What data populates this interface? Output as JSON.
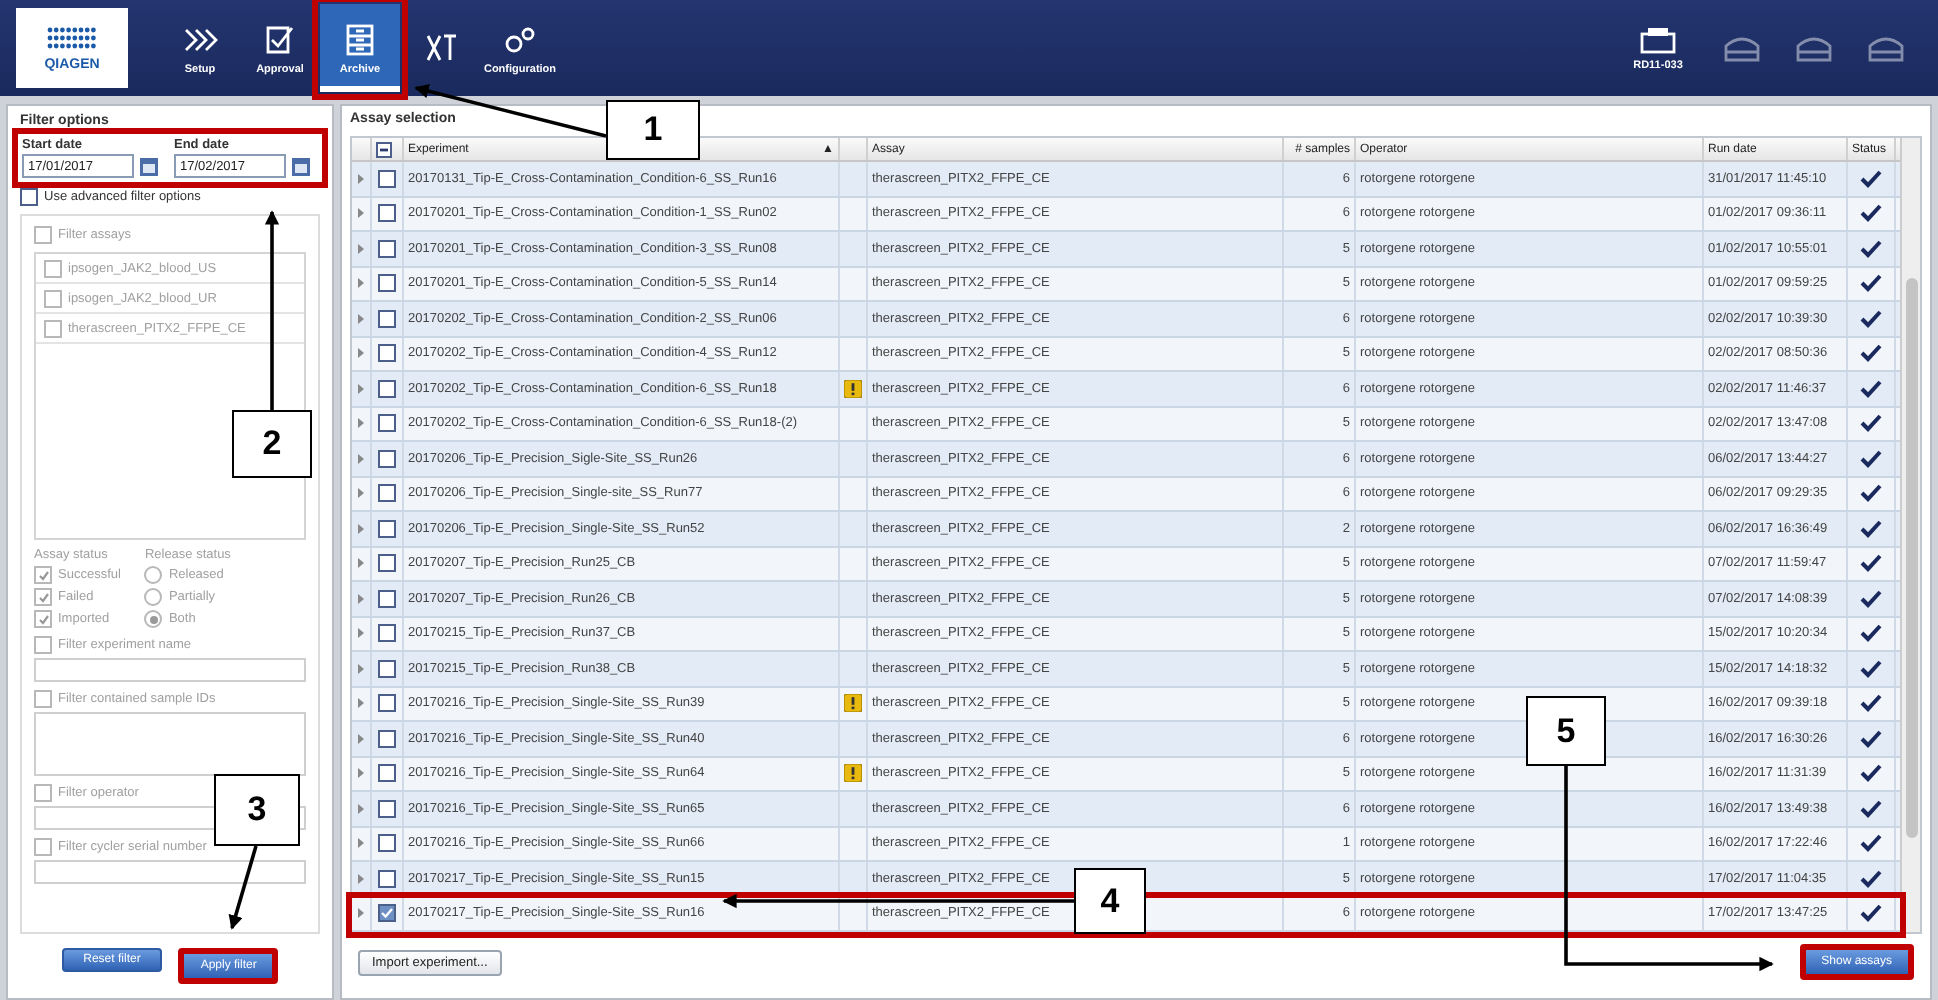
{
  "toolbar": {
    "logo": "QIAGEN",
    "nav": [
      {
        "label": "Setup",
        "selected": false,
        "highlighted": false
      },
      {
        "label": "Approval",
        "selected": false,
        "highlighted": false
      },
      {
        "label": "Archive",
        "selected": true,
        "highlighted": true
      },
      {
        "selected": false,
        "highlighted": false
      },
      {
        "label": "Configuration",
        "selected": false,
        "highlighted": false
      }
    ],
    "instrument": {
      "label": "RD11-033"
    },
    "slots": [
      {
        "disabled": true
      },
      {
        "disabled": true
      },
      {
        "disabled": true
      }
    ]
  },
  "filter": {
    "title": "Filter options",
    "dates_highlighted": true,
    "start_date": {
      "label": "Start date",
      "value": "17/01/2017"
    },
    "end_date": {
      "label": "End date",
      "value": "17/02/2017"
    },
    "advanced": {
      "label": "Use advanced filter options",
      "checked": false
    },
    "filter_assays": {
      "label": "Filter assays",
      "checked": false,
      "items": [
        {
          "label": "ipsogen_JAK2_blood_US",
          "checked": false
        },
        {
          "label": "ipsogen_JAK2_blood_UR",
          "checked": false
        },
        {
          "label": "therascreen_PITX2_FFPE_CE",
          "checked": false
        }
      ]
    },
    "assay_status": {
      "title": "Assay status",
      "items": [
        {
          "label": "Successful",
          "checked": true
        },
        {
          "label": "Failed",
          "checked": true
        },
        {
          "label": "Imported",
          "checked": true
        }
      ]
    },
    "release_status": {
      "title": "Release status",
      "items": [
        {
          "label": "Released",
          "selected": false
        },
        {
          "label": "Partially",
          "selected": false
        },
        {
          "label": "Both",
          "selected": true
        }
      ]
    },
    "text_filters": [
      {
        "label": "Filter experiment name",
        "checked": false,
        "kind": "text"
      },
      {
        "label": "Filter contained sample IDs",
        "checked": false,
        "kind": "area"
      },
      {
        "label": "Filter operator",
        "checked": false,
        "kind": "select"
      },
      {
        "label": "Filter cycler serial number",
        "checked": false,
        "kind": "text"
      }
    ],
    "buttons": [
      {
        "label": "Reset filter",
        "highlighted": false
      },
      {
        "label": "Apply filter",
        "highlighted": true
      }
    ]
  },
  "assay_selection": {
    "title": "Assay selection",
    "columns": [
      "Experiment",
      "Assay",
      "# samples",
      "Operator",
      "Run date",
      "Status"
    ],
    "sort_mark": "▲",
    "header_partial": true,
    "rows": [
      {
        "experiment": "20170131_Tip-E_Cross-Contamination_Condition-6_SS_Run16",
        "warning": false,
        "assay": "therascreen_PITX2_FFPE_CE",
        "samples": "6",
        "operator": "rotorgene rotorgene",
        "run_date": "31/01/2017 11:45:10",
        "passed": true,
        "checked": false,
        "highlighted": false
      },
      {
        "experiment": "20170201_Tip-E_Cross-Contamination_Condition-1_SS_Run02",
        "warning": false,
        "assay": "therascreen_PITX2_FFPE_CE",
        "samples": "6",
        "operator": "rotorgene rotorgene",
        "run_date": "01/02/2017 09:36:11",
        "passed": true,
        "checked": false,
        "highlighted": false
      },
      {
        "experiment": "20170201_Tip-E_Cross-Contamination_Condition-3_SS_Run08",
        "warning": false,
        "assay": "therascreen_PITX2_FFPE_CE",
        "samples": "5",
        "operator": "rotorgene rotorgene",
        "run_date": "01/02/2017 10:55:01",
        "passed": true,
        "checked": false,
        "highlighted": false
      },
      {
        "experiment": "20170201_Tip-E_Cross-Contamination_Condition-5_SS_Run14",
        "warning": false,
        "assay": "therascreen_PITX2_FFPE_CE",
        "samples": "5",
        "operator": "rotorgene rotorgene",
        "run_date": "01/02/2017 09:59:25",
        "passed": true,
        "checked": false,
        "highlighted": false
      },
      {
        "experiment": "20170202_Tip-E_Cross-Contamination_Condition-2_SS_Run06",
        "warning": false,
        "assay": "therascreen_PITX2_FFPE_CE",
        "samples": "6",
        "operator": "rotorgene rotorgene",
        "run_date": "02/02/2017 10:39:30",
        "passed": true,
        "checked": false,
        "highlighted": false
      },
      {
        "experiment": "20170202_Tip-E_Cross-Contamination_Condition-4_SS_Run12",
        "warning": false,
        "assay": "therascreen_PITX2_FFPE_CE",
        "samples": "5",
        "operator": "rotorgene rotorgene",
        "run_date": "02/02/2017 08:50:36",
        "passed": true,
        "checked": false,
        "highlighted": false
      },
      {
        "experiment": "20170202_Tip-E_Cross-Contamination_Condition-6_SS_Run18",
        "warning": true,
        "assay": "therascreen_PITX2_FFPE_CE",
        "samples": "6",
        "operator": "rotorgene rotorgene",
        "run_date": "02/02/2017 11:46:37",
        "passed": true,
        "checked": false,
        "highlighted": false
      },
      {
        "experiment": "20170202_Tip-E_Cross-Contamination_Condition-6_SS_Run18-(2)",
        "warning": false,
        "assay": "therascreen_PITX2_FFPE_CE",
        "samples": "5",
        "operator": "rotorgene rotorgene",
        "run_date": "02/02/2017 13:47:08",
        "passed": true,
        "checked": false,
        "highlighted": false
      },
      {
        "experiment": "20170206_Tip-E_Precision_Sigle-Site_SS_Run26",
        "warning": false,
        "assay": "therascreen_PITX2_FFPE_CE",
        "samples": "6",
        "operator": "rotorgene rotorgene",
        "run_date": "06/02/2017 13:44:27",
        "passed": true,
        "checked": false,
        "highlighted": false
      },
      {
        "experiment": "20170206_Tip-E_Precision_Single-site_SS_Run77",
        "warning": false,
        "assay": "therascreen_PITX2_FFPE_CE",
        "samples": "6",
        "operator": "rotorgene rotorgene",
        "run_date": "06/02/2017 09:29:35",
        "passed": true,
        "checked": false,
        "highlighted": false
      },
      {
        "experiment": "20170206_Tip-E_Precision_Single-Site_SS_Run52",
        "warning": false,
        "assay": "therascreen_PITX2_FFPE_CE",
        "samples": "2",
        "operator": "rotorgene rotorgene",
        "run_date": "06/02/2017 16:36:49",
        "passed": true,
        "checked": false,
        "highlighted": false
      },
      {
        "experiment": "20170207_Tip-E_Precision_Run25_CB",
        "warning": false,
        "assay": "therascreen_PITX2_FFPE_CE",
        "samples": "5",
        "operator": "rotorgene rotorgene",
        "run_date": "07/02/2017 11:59:47",
        "passed": true,
        "checked": false,
        "highlighted": false
      },
      {
        "experiment": "20170207_Tip-E_Precision_Run26_CB",
        "warning": false,
        "assay": "therascreen_PITX2_FFPE_CE",
        "samples": "5",
        "operator": "rotorgene rotorgene",
        "run_date": "07/02/2017 14:08:39",
        "passed": true,
        "checked": false,
        "highlighted": false
      },
      {
        "experiment": "20170215_Tip-E_Precision_Run37_CB",
        "warning": false,
        "assay": "therascreen_PITX2_FFPE_CE",
        "samples": "5",
        "operator": "rotorgene rotorgene",
        "run_date": "15/02/2017 10:20:34",
        "passed": true,
        "checked": false,
        "highlighted": false
      },
      {
        "experiment": "20170215_Tip-E_Precision_Run38_CB",
        "warning": false,
        "assay": "therascreen_PITX2_FFPE_CE",
        "samples": "5",
        "operator": "rotorgene rotorgene",
        "run_date": "15/02/2017 14:18:32",
        "passed": true,
        "checked": false,
        "highlighted": false
      },
      {
        "experiment": "20170216_Tip-E_Precision_Single-Site_SS_Run39",
        "warning": true,
        "assay": "therascreen_PITX2_FFPE_CE",
        "samples": "5",
        "operator": "rotorgene rotorgene",
        "run_date": "16/02/2017 09:39:18",
        "passed": true,
        "checked": false,
        "highlighted": false
      },
      {
        "experiment": "20170216_Tip-E_Precision_Single-Site_SS_Run40",
        "warning": false,
        "assay": "therascreen_PITX2_FFPE_CE",
        "samples": "6",
        "operator": "rotorgene rotorgene",
        "run_date": "16/02/2017 16:30:26",
        "passed": true,
        "checked": false,
        "highlighted": false
      },
      {
        "experiment": "20170216_Tip-E_Precision_Single-Site_SS_Run64",
        "warning": true,
        "assay": "therascreen_PITX2_FFPE_CE",
        "samples": "5",
        "operator": "rotorgene rotorgene",
        "run_date": "16/02/2017 11:31:39",
        "passed": true,
        "checked": false,
        "highlighted": false
      },
      {
        "experiment": "20170216_Tip-E_Precision_Single-Site_SS_Run65",
        "warning": false,
        "assay": "therascreen_PITX2_FFPE_CE",
        "samples": "6",
        "operator": "rotorgene rotorgene",
        "run_date": "16/02/2017 13:49:38",
        "passed": true,
        "checked": false,
        "highlighted": false
      },
      {
        "experiment": "20170216_Tip-E_Precision_Single-Site_SS_Run66",
        "warning": false,
        "assay": "therascreen_PITX2_FFPE_CE",
        "samples": "1",
        "operator": "rotorgene rotorgene",
        "run_date": "16/02/2017 17:22:46",
        "passed": true,
        "checked": false,
        "highlighted": false
      },
      {
        "experiment": "20170217_Tip-E_Precision_Single-Site_SS_Run15",
        "warning": false,
        "assay": "therascreen_PITX2_FFPE_CE",
        "samples": "5",
        "operator": "rotorgene rotorgene",
        "run_date": "17/02/2017 11:04:35",
        "passed": true,
        "checked": false,
        "highlighted": false
      },
      {
        "experiment": "20170217_Tip-E_Precision_Single-Site_SS_Run16",
        "warning": false,
        "assay": "therascreen_PITX2_FFPE_CE",
        "samples": "6",
        "operator": "rotorgene rotorgene",
        "run_date": "17/02/2017 13:47:25",
        "passed": true,
        "checked": true,
        "highlighted": true
      }
    ],
    "buttons": [
      {
        "label": "Import experiment...",
        "highlighted": false
      },
      {
        "label": "Show assays",
        "highlighted": true
      }
    ]
  },
  "callouts": [
    "1",
    "2",
    "3",
    "4",
    "5"
  ]
}
